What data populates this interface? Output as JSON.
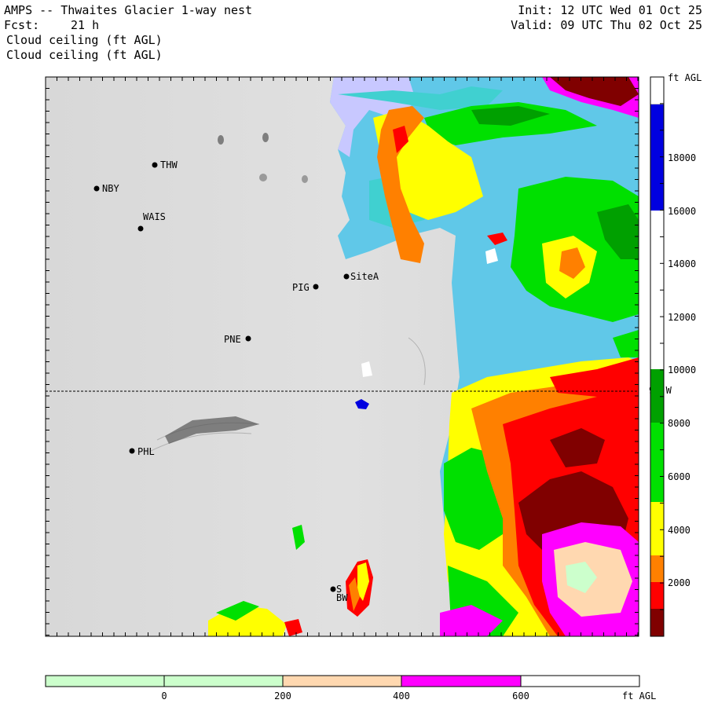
{
  "header": {
    "model": "AMPS -- Thwaites Glacier 1-way nest",
    "forecast_label": "Fcst:",
    "forecast_hours": "21 h",
    "variable_line1": "Cloud ceiling (ft AGL)",
    "variable_line2": "Cloud ceiling (ft AGL)",
    "init": "Init: 12 UTC Wed 01 Oct 25",
    "valid": "Valid: 09 UTC Thu 02 Oct 25"
  },
  "stations": [
    "THW",
    "NBY",
    "WAIS",
    "SiteA",
    "PIG",
    "PNE",
    "PHL",
    "S",
    "BW"
  ],
  "meridian_label": "90 W",
  "colorbar_right": {
    "unit": "ft AGL",
    "ticks": [
      "18000",
      "16000",
      "14000",
      "12000",
      "10000",
      "8000",
      "6000",
      "4000",
      "2000"
    ],
    "colors": {
      "dark_red": "#800000",
      "red": "#ff0000",
      "orange": "#ff8000",
      "yellow": "#ffff00",
      "green": "#00e000",
      "dark_green": "#00a000",
      "white": "#ffffff",
      "blue": "#0000e0"
    }
  },
  "colorbar_bottom": {
    "unit": "ft AGL",
    "ticks": [
      "0",
      "200",
      "400",
      "600"
    ],
    "colors": {
      "light_green": "#ccffcc",
      "peach": "#ffd8b0",
      "magenta": "#ff00ff",
      "white": "#ffffff"
    }
  },
  "map_colors": {
    "terrain": "#dcdcdc",
    "light_blue": "#60c8e8",
    "cyan": "#40d0d0",
    "lavender": "#c8c8ff"
  }
}
